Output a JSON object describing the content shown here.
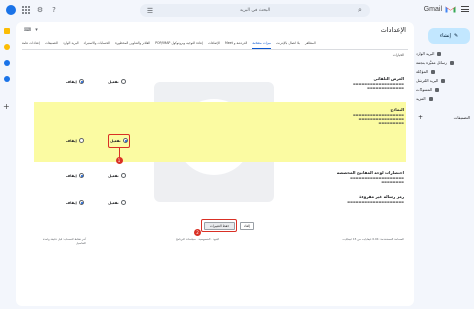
{
  "header": {
    "search_placeholder": "البحث في البريد",
    "app_name": "Gmail"
  },
  "nav": {
    "compose_label": "إنشاء",
    "items": [
      {
        "label": "البريد الوارد"
      },
      {
        "label": "رسائل مميَّزة بنجمة"
      },
      {
        "label": "المؤجّلة"
      },
      {
        "label": "البريد المُرسَل"
      },
      {
        "label": "المسودّات"
      },
      {
        "label": "المزيد"
      }
    ],
    "labels_title": "التصنيفات",
    "labels_add": "+"
  },
  "settings": {
    "title": "الإعدادات",
    "tabs": [
      {
        "label": "إعدادات عامة",
        "active": true
      },
      {
        "label": "التصنيفات"
      },
      {
        "label": "البريد الوارد"
      },
      {
        "label": "الحسابات والاستيراد"
      },
      {
        "label": "الفلاتر والعناوين المحظورة"
      },
      {
        "label": "إعادة التوجيه وبروتوكول POP/IMAP"
      },
      {
        "label": "الإضافات"
      },
      {
        "label": "الدردشة و Meet"
      },
      {
        "label": "ميزات متقدّمة"
      },
      {
        "label": "بلا اتصال بالإنترنت"
      },
      {
        "label": "المظاهر"
      }
    ],
    "link": "الخيارات",
    "sections": [
      {
        "title": "العرض التلقائي",
        "option_on": "تفعيل",
        "option_off": "إيقاف"
      },
      {
        "title": "النماذج",
        "option_on": "تفعيل",
        "option_off": "إيقاف"
      },
      {
        "title": "اختصارات لوحة المفاتيح المخصصة",
        "option_on": "تفعيل",
        "option_off": "إيقاف"
      },
      {
        "title": "رمز رسالة غير مقروءة",
        "option_on": "تفعيل",
        "option_off": "إيقاف"
      }
    ],
    "save_label": "حفظ التغييرات",
    "cancel_label": "إلغاء",
    "step1": "1",
    "step2": "2"
  },
  "footer": {
    "storage": "المساحة المستخدمة: 0.04 غيغابايت من 15 غيغابايت",
    "terms": "البنود · الخصوصية · سياسات البرنامج",
    "activity": "آخر نشاط للحساب: قبل دقيقة واحدة",
    "details": "التفاصيل"
  },
  "colors": {
    "highlight": "#fbfba2",
    "annotation": "#d93025",
    "accent": "#0b57d0"
  }
}
